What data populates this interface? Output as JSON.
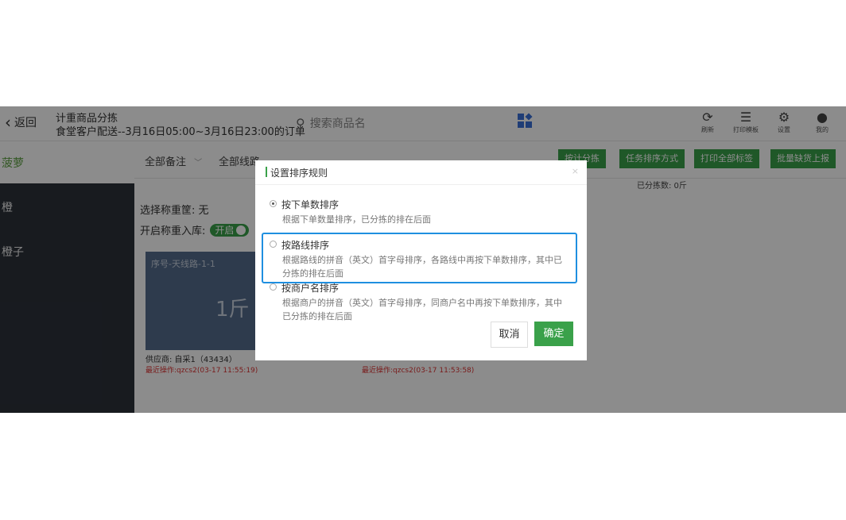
{
  "header": {
    "back_label": "返回",
    "title": "计重商品分拣",
    "subtitle": "食堂客户配送--3月16日05:00~3月16日23:00的订单",
    "search_placeholder": "搜索商品名",
    "icons": [
      {
        "label": "刷新",
        "icon": "refresh-icon"
      },
      {
        "label": "打印模板",
        "icon": "print-template-icon"
      },
      {
        "label": "设置",
        "icon": "gear-icon"
      },
      {
        "label": "我的",
        "icon": "user-icon"
      }
    ]
  },
  "sidebar": {
    "selected": "菠萝",
    "items": [
      "橙",
      "橙子"
    ]
  },
  "filters": {
    "remark": "全部备注",
    "route": "全部线路"
  },
  "toolbar": {
    "btn_sort_pick": "按计分拣",
    "btn_task_order": "任务排序方式",
    "btn_print_all": "打印全部标签",
    "btn_batch_report": "批量缺货上报"
  },
  "sorted_count": "已分拣数: 0斤",
  "panel": {
    "weight_basket_label": "选择称重筐:",
    "weight_basket_value": "无",
    "stock_label": "开启称重入库:",
    "stock_toggle": "开启"
  },
  "card": {
    "title": "序号-天线路-1-1",
    "weight": "1斤"
  },
  "supplier": "供应商: 自采1（43434）",
  "last_op_1": "最近操作:qzcs2(03-17 11:55:19)",
  "last_op_2": "最近操作:qzcs2(03-17 11:53:58)",
  "modal": {
    "title": "设置排序规则",
    "close": "×",
    "options": [
      {
        "label": "按下单数排序",
        "desc": "根据下单数量排序，已分拣的排在后面",
        "checked": true
      },
      {
        "label": "按路线排序",
        "desc": "根据路线的拼音（英文）首字母排序，各路线中再按下单数排序，其中已分拣的排在后面",
        "checked": false
      },
      {
        "label": "按商户名排序",
        "desc": "根据商户的拼音（英文）首字母排序，同商户名中再按下单数排序，其中已分拣的排在后面",
        "checked": false
      }
    ],
    "cancel": "取消",
    "confirm": "确定"
  }
}
